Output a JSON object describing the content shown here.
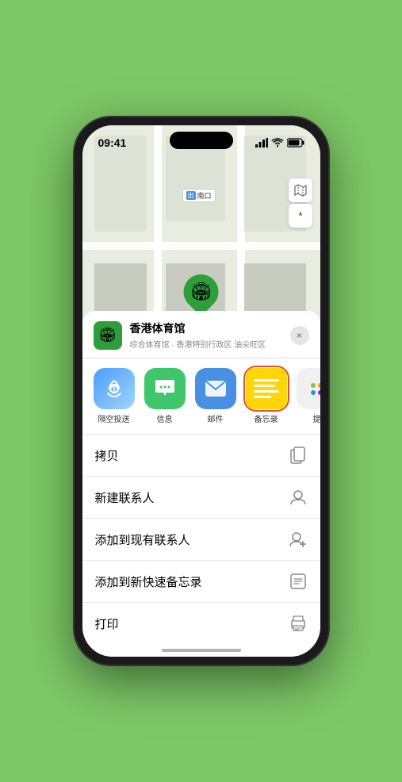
{
  "status_bar": {
    "time": "09:41",
    "signal": "●●●",
    "wifi": "wifi",
    "battery": "battery"
  },
  "map": {
    "label_text": "南口",
    "label_tag": "出",
    "pin_label": "香港体育馆"
  },
  "map_controls": {
    "map_icon": "🗺",
    "location_icon": "⬆"
  },
  "venue_card": {
    "name": "香港体育馆",
    "subtitle": "综合体育馆 · 香港特别行政区 油尖旺区",
    "close_label": "×"
  },
  "share_items": [
    {
      "id": "airdrop",
      "label": "隔空投送",
      "type": "airdrop"
    },
    {
      "id": "message",
      "label": "信息",
      "type": "message"
    },
    {
      "id": "mail",
      "label": "邮件",
      "type": "mail"
    },
    {
      "id": "notes",
      "label": "备忘录",
      "type": "notes"
    },
    {
      "id": "more",
      "label": "提",
      "type": "more"
    }
  ],
  "actions": [
    {
      "id": "copy",
      "label": "拷贝",
      "icon": "copy"
    },
    {
      "id": "new-contact",
      "label": "新建联系人",
      "icon": "person-add"
    },
    {
      "id": "add-contact",
      "label": "添加到现有联系人",
      "icon": "person-plus"
    },
    {
      "id": "quick-notes",
      "label": "添加到新快速备忘录",
      "icon": "note"
    },
    {
      "id": "print",
      "label": "打印",
      "icon": "printer"
    }
  ]
}
